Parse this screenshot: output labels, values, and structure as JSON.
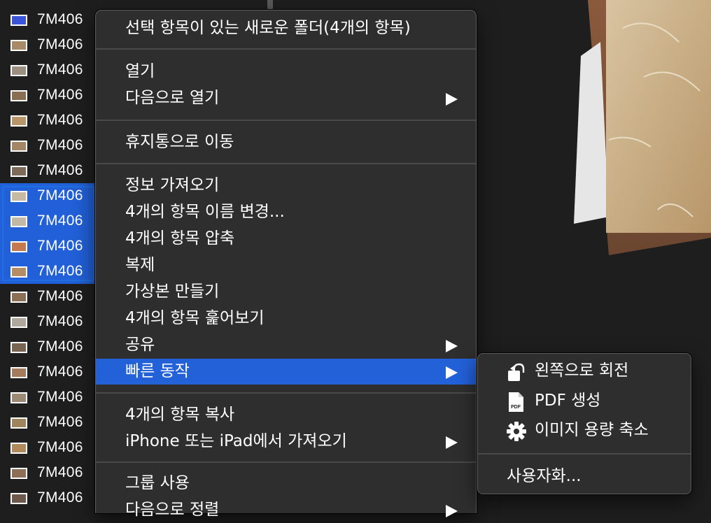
{
  "file_list": {
    "rows": [
      {
        "name": "7M406",
        "selected": false,
        "thumb": "#3a55d8"
      },
      {
        "name": "7M406",
        "selected": false,
        "thumb": "#a88a66"
      },
      {
        "name": "7M406",
        "selected": false,
        "thumb": "#9a8f80"
      },
      {
        "name": "7M406",
        "selected": false,
        "thumb": "#8a6e52"
      },
      {
        "name": "7M406",
        "selected": false,
        "thumb": "#b8966a"
      },
      {
        "name": "7M406",
        "selected": false,
        "thumb": "#a48564"
      },
      {
        "name": "7M406",
        "selected": false,
        "thumb": "#7d6a58"
      },
      {
        "name": "7M406",
        "selected": true,
        "thumb": "#c8b9a3"
      },
      {
        "name": "7M406",
        "selected": true,
        "thumb": "#c2b8a8"
      },
      {
        "name": "7M406",
        "selected": true,
        "thumb": "#c47a4e"
      },
      {
        "name": "7M406",
        "selected": true,
        "thumb": "#b48d64"
      },
      {
        "name": "7M406",
        "selected": false,
        "thumb": "#8c7056"
      },
      {
        "name": "7M406",
        "selected": false,
        "thumb": "#b0a89c"
      },
      {
        "name": "7M406",
        "selected": false,
        "thumb": "#7a6552"
      },
      {
        "name": "7M406",
        "selected": false,
        "thumb": "#a47c5c"
      },
      {
        "name": "7M406",
        "selected": false,
        "thumb": "#9c8a74"
      },
      {
        "name": "7M406",
        "selected": false,
        "thumb": "#a0845e"
      },
      {
        "name": "7M406",
        "selected": false,
        "thumb": "#b08a5a"
      },
      {
        "name": "7M406",
        "selected": false,
        "thumb": "#8e6e54"
      },
      {
        "name": "7M406",
        "selected": false,
        "thumb": "#6e5a4c"
      }
    ]
  },
  "context_menu": {
    "items": [
      {
        "label": "선택 항목이 있는 새로운 폴더(4개의 항목)",
        "submenu": false
      },
      {
        "label": "열기",
        "submenu": false
      },
      {
        "label": "다음으로 열기",
        "submenu": true
      },
      {
        "label": "휴지통으로 이동",
        "submenu": false
      },
      {
        "label": "정보 가져오기",
        "submenu": false
      },
      {
        "label": "4개의 항목 이름 변경...",
        "submenu": false
      },
      {
        "label": "4개의 항목 압축",
        "submenu": false
      },
      {
        "label": "복제",
        "submenu": false
      },
      {
        "label": "가상본 만들기",
        "submenu": false
      },
      {
        "label": "4개의 항목 훑어보기",
        "submenu": false
      },
      {
        "label": "공유",
        "submenu": true
      },
      {
        "label": "빠른 동작",
        "submenu": true,
        "highlighted": true
      },
      {
        "label": "4개의 항목 복사",
        "submenu": false
      },
      {
        "label": "iPhone 또는 iPad에서 가져오기",
        "submenu": true
      },
      {
        "label": "그룹 사용",
        "submenu": false
      },
      {
        "label": "다음으로 정렬",
        "submenu": true
      }
    ]
  },
  "quick_actions_submenu": {
    "items": [
      {
        "label": "왼쪽으로 회전",
        "icon": "rotate-left-icon"
      },
      {
        "label": "PDF 생성",
        "icon": "pdf-file-icon",
        "icon_text": "PDF"
      },
      {
        "label": "이미지 용량 축소",
        "icon": "gear-icon"
      }
    ],
    "customize_label": "사용자화..."
  },
  "colors": {
    "highlight": "#2361d9",
    "menu_bg": "#2e2e2e",
    "selection": "#2160d8"
  }
}
